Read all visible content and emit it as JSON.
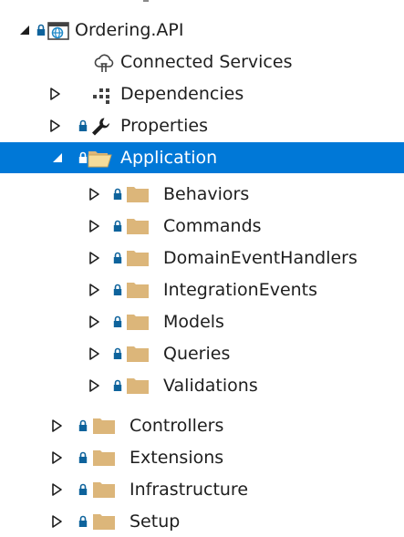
{
  "tree": {
    "project": {
      "label": "Ordering.API"
    },
    "connected_services": {
      "label": "Connected Services"
    },
    "dependencies": {
      "label": "Dependencies"
    },
    "properties": {
      "label": "Properties"
    },
    "application": {
      "label": "Application",
      "children": [
        {
          "label": "Behaviors"
        },
        {
          "label": "Commands"
        },
        {
          "label": "DomainEventHandlers"
        },
        {
          "label": "IntegrationEvents"
        },
        {
          "label": "Models"
        },
        {
          "label": "Queries"
        },
        {
          "label": "Validations"
        }
      ]
    },
    "folders": [
      {
        "label": "Controllers"
      },
      {
        "label": "Extensions"
      },
      {
        "label": "Infrastructure"
      },
      {
        "label": "Setup"
      }
    ]
  },
  "colors": {
    "selection": "#0078d7",
    "folder": "#dcb67a",
    "lock": "#0e639c",
    "text": "#1e1e1e"
  },
  "icons": {
    "project": "web-project-icon",
    "connected_services": "connected-services-icon",
    "dependencies": "dependencies-icon",
    "properties": "wrench-icon",
    "folder": "folder-icon",
    "lock": "lock-icon",
    "expanded": "triangle-expanded-icon",
    "collapsed": "triangle-collapsed-icon"
  }
}
